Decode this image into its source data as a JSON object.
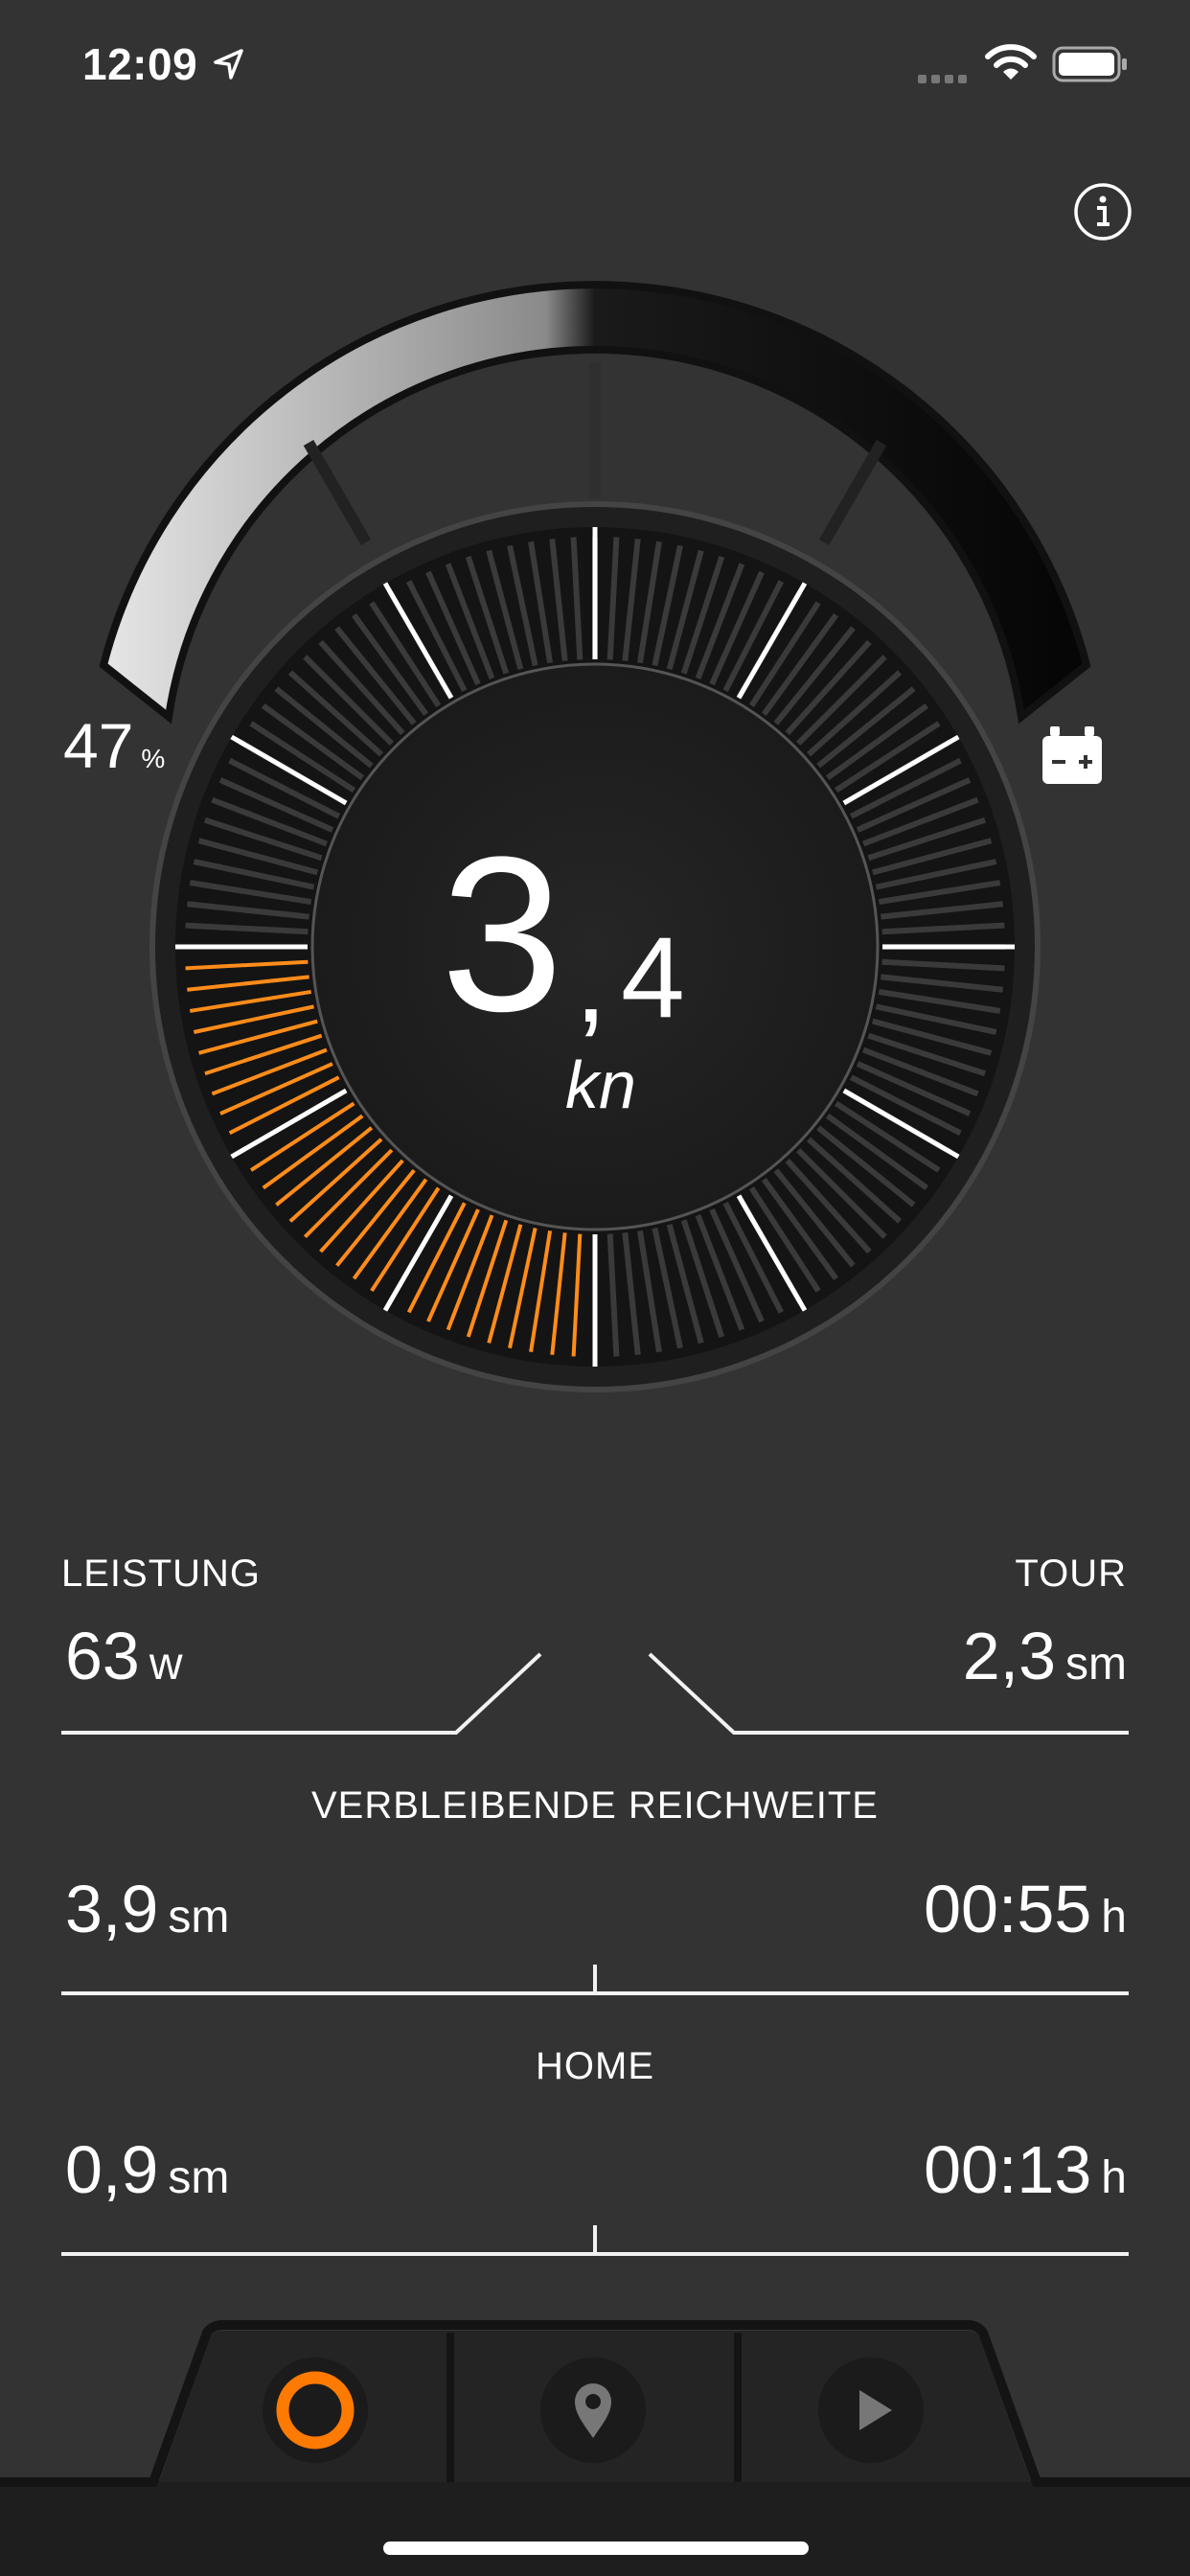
{
  "status": {
    "time": "12:09"
  },
  "gauge": {
    "speed_int": "3",
    "speed_sep": ",",
    "speed_dec": "4",
    "speed_unit": "kn",
    "battery_value": "47",
    "battery_unit": "%",
    "battery_level": 0.47,
    "speed_fill_fraction": 0.5,
    "accent_color": "#ff8c1a"
  },
  "stats": {
    "power_label": "LEISTUNG",
    "power_value": "63",
    "power_unit": "w",
    "tour_label": "TOUR",
    "tour_value": "2,3",
    "tour_unit": "sm",
    "range_label": "VERBLEIBENDE REICHWEITE",
    "range_distance": "3,9",
    "range_distance_unit": "sm",
    "range_time": "00:55",
    "range_time_unit": "h",
    "home_label": "HOME",
    "home_distance": "0,9",
    "home_distance_unit": "sm",
    "home_time": "00:13",
    "home_time_unit": "h"
  },
  "tabs": [
    {
      "name": "dashboard",
      "icon": "ring-icon",
      "active": true
    },
    {
      "name": "map",
      "icon": "map-pin-icon",
      "active": false
    },
    {
      "name": "play",
      "icon": "play-icon",
      "active": false
    }
  ]
}
